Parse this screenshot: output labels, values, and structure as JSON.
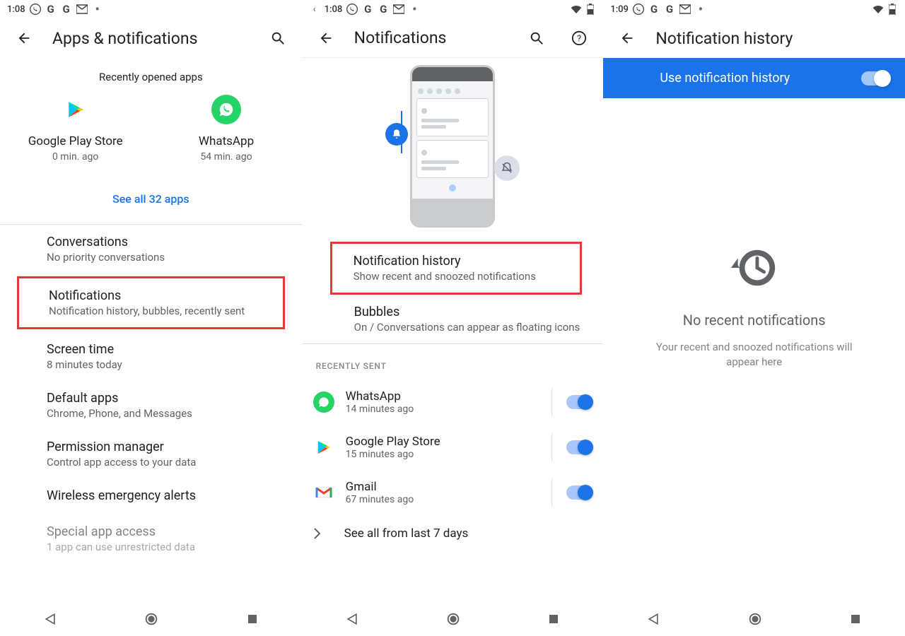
{
  "s1": {
    "time": "1:08",
    "title": "Apps & notifications",
    "section": "Recently opened apps",
    "apps": [
      {
        "name": "Google Play Store",
        "time": "0 min. ago"
      },
      {
        "name": "WhatsApp",
        "time": "54 min. ago"
      }
    ],
    "see_all": "See all 32 apps",
    "items": [
      {
        "t": "Conversations",
        "s": "No priority conversations"
      },
      {
        "t": "Notifications",
        "s": "Notification history, bubbles, recently sent"
      },
      {
        "t": "Screen time",
        "s": "8 minutes today"
      },
      {
        "t": "Default apps",
        "s": "Chrome, Phone, and Messages"
      },
      {
        "t": "Permission manager",
        "s": "Control app access to your data"
      },
      {
        "t": "Wireless emergency alerts",
        "s": ""
      },
      {
        "t": "Special app access",
        "s": "1 app can use unrestricted data"
      }
    ]
  },
  "s2": {
    "time": "1:08",
    "title": "Notifications",
    "items": [
      {
        "t": "Notification history",
        "s": "Show recent and snoozed notifications"
      },
      {
        "t": "Bubbles",
        "s": "On / Conversations can appear as floating icons"
      }
    ],
    "subhead": "RECENTLY SENT",
    "sent": [
      {
        "t": "WhatsApp",
        "s": "14 minutes ago"
      },
      {
        "t": "Google Play Store",
        "s": "15 minutes ago"
      },
      {
        "t": "Gmail",
        "s": "67 minutes ago"
      }
    ],
    "more": "See all from last 7 days"
  },
  "s3": {
    "time": "1:09",
    "title": "Notification history",
    "toggle": "Use notification history",
    "empty_t": "No recent notifications",
    "empty_s": "Your recent and snoozed notifications will appear here"
  }
}
